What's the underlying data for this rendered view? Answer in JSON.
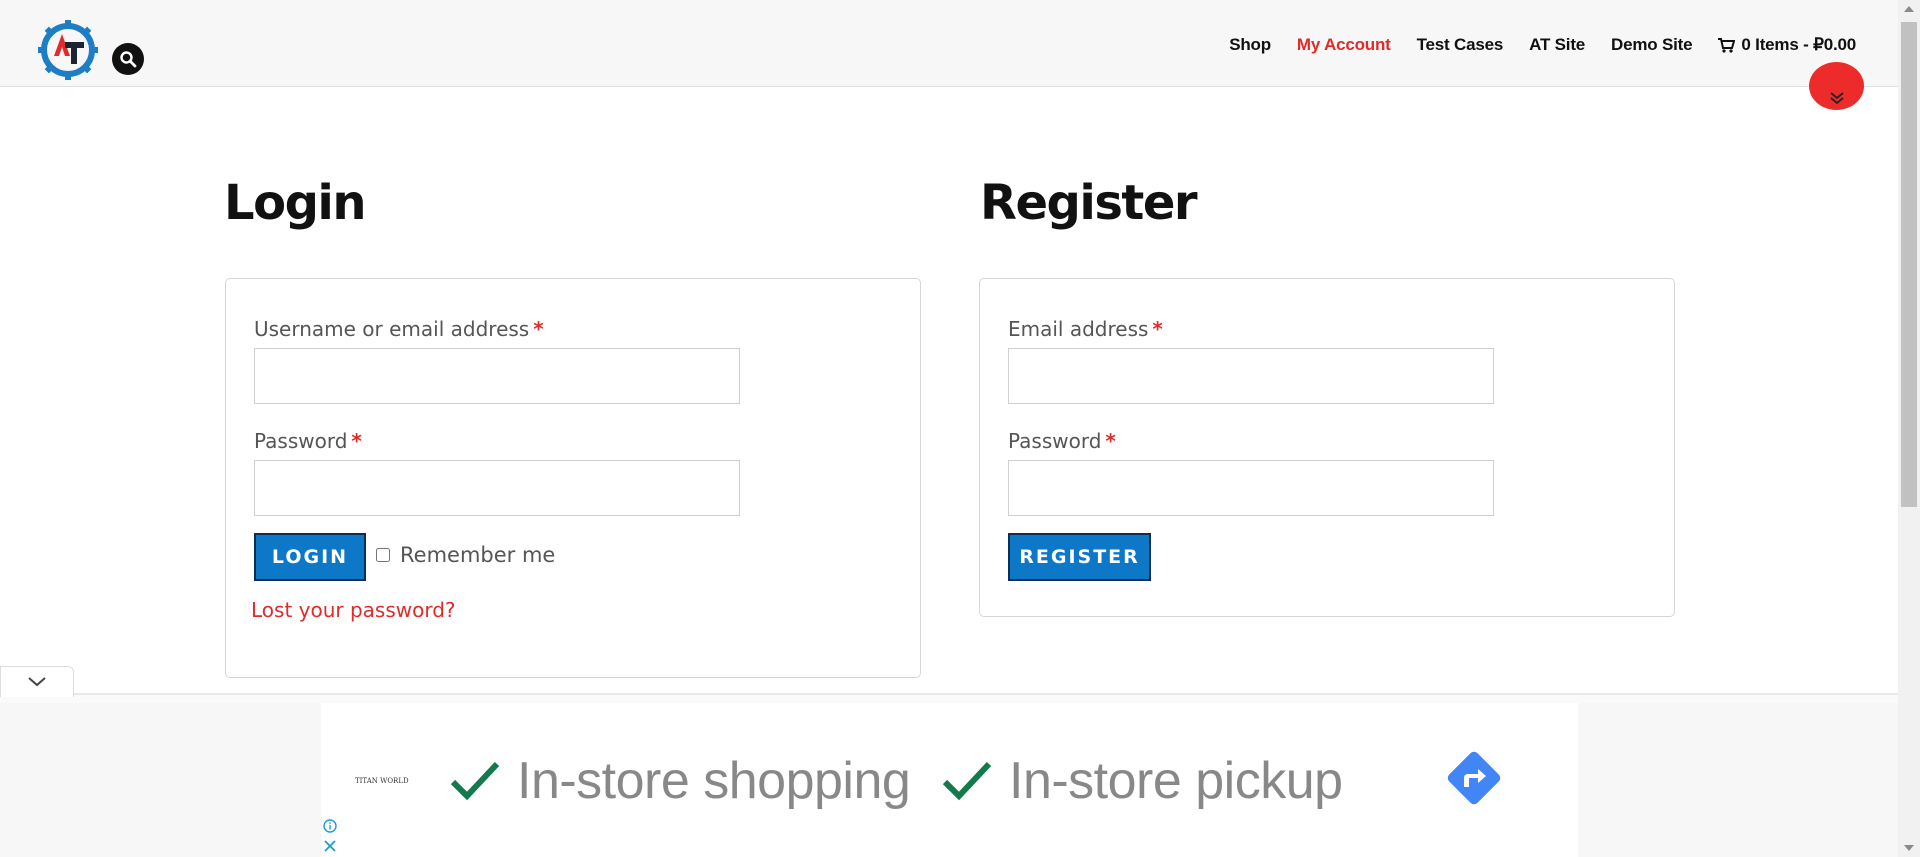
{
  "nav": {
    "items": [
      {
        "label": "Shop"
      },
      {
        "label": "My Account"
      },
      {
        "label": "Test Cases"
      },
      {
        "label": "AT Site"
      },
      {
        "label": "Demo Site"
      }
    ],
    "cart": {
      "label": "0 Items - ₽0.00"
    }
  },
  "login": {
    "title": "Login",
    "username_label": "Username or email address",
    "password_label": "Password",
    "required_mark": "*",
    "button_label": "LOGIN",
    "remember_label": "Remember me",
    "lost_password": "Lost your password?"
  },
  "register": {
    "title": "Register",
    "email_label": "Email address",
    "password_label": "Password",
    "required_mark": "*",
    "button_label": "REGISTER"
  },
  "ad": {
    "brand": "TITAN WORLD",
    "item1": "In-store shopping",
    "item2": "In-store pickup"
  },
  "colors": {
    "accent_red": "#e02b2b",
    "button_blue": "#0d78c8",
    "check_green": "#137b4b",
    "directions_blue": "#4285f4"
  }
}
